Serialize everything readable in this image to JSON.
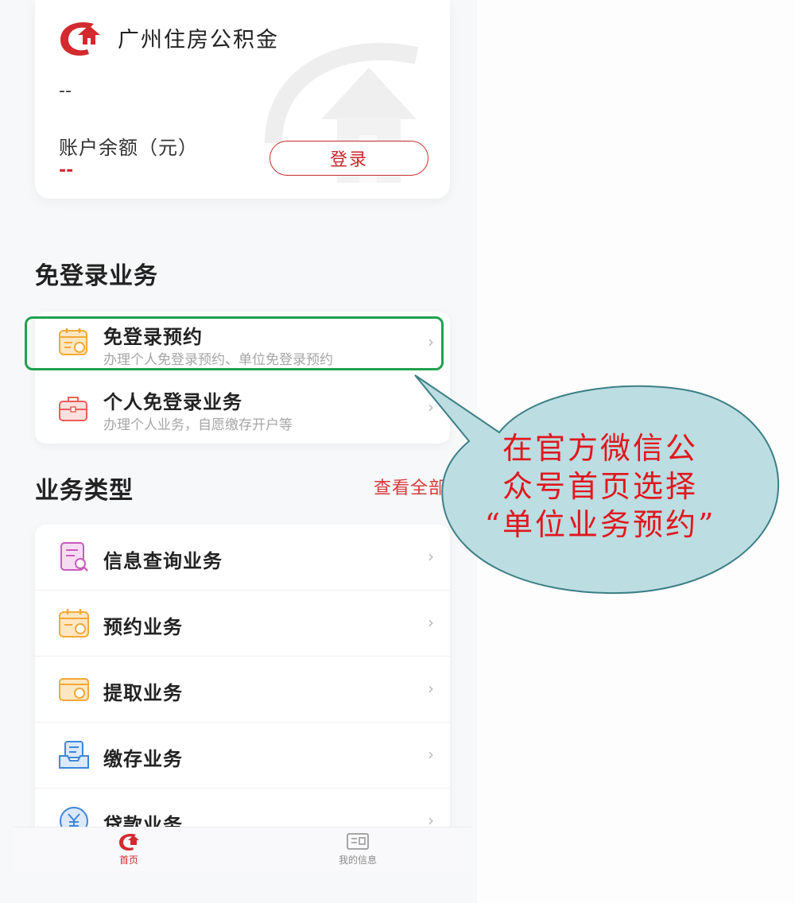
{
  "account": {
    "brand_name": "广州住房公积金",
    "account_number": "--",
    "balance_label": "账户余额（元）",
    "balance_value": "--",
    "login_label": "登录"
  },
  "quick_services": {
    "title": "免登录业务",
    "items": [
      {
        "title": "免登录预约",
        "subtitle": "办理个人免登录预约、单位免登录预约",
        "icon": "calendar-icon"
      },
      {
        "title": "个人免登录业务",
        "subtitle": "办理个人业务，自愿缴存开户等",
        "icon": "briefcase-icon"
      }
    ]
  },
  "business_types": {
    "title": "业务类型",
    "view_all_label": "查看全部",
    "items": [
      {
        "label": "信息查询业务",
        "icon": "document-search-icon"
      },
      {
        "label": "预约业务",
        "icon": "calendar-icon"
      },
      {
        "label": "提取业务",
        "icon": "withdraw-card-icon"
      },
      {
        "label": "缴存业务",
        "icon": "deposit-tray-icon"
      },
      {
        "label": "贷款业务",
        "icon": "yuan-coin-icon"
      }
    ]
  },
  "tabbar": {
    "tabs": [
      {
        "label": "首页",
        "active": true
      },
      {
        "label": "我的信息",
        "active": false
      }
    ]
  },
  "callout": {
    "lines": [
      "在官方微信公",
      "众号首页选择",
      "“单位业务预约”"
    ]
  },
  "colors": {
    "brand_red": "#d22a2f",
    "highlight_green": "#21a14f",
    "callout_fill": "#bcdde1",
    "callout_text": "#e0171e"
  }
}
